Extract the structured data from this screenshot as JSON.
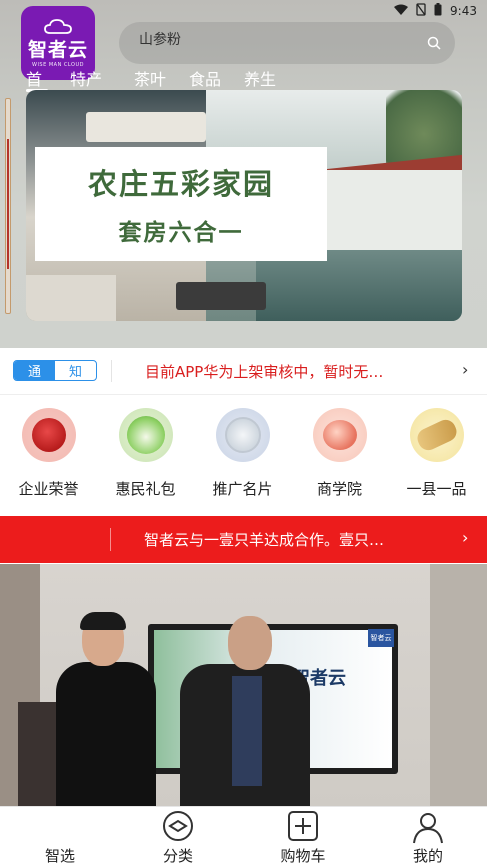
{
  "status_bar": {
    "time": "9:43"
  },
  "logo": {
    "text": "智者云",
    "sub": "WISE MAN CLOUD"
  },
  "search": {
    "placeholder": "山参粉"
  },
  "category_tabs": [
    "首",
    "特产",
    "茶叶",
    "食品",
    "养生"
  ],
  "banner": {
    "title": "农庄五彩家园",
    "subtitle": "套房六合一"
  },
  "notice": {
    "tag1": "通",
    "tag2": "知",
    "message": "目前APP华为上架审核中，暂时无…",
    "chevron": "›"
  },
  "quick_categories": [
    {
      "label": "企业荣誉",
      "icon": "rose-icon"
    },
    {
      "label": "惠民礼包",
      "icon": "cabbage-icon"
    },
    {
      "label": "推广名片",
      "icon": "card-icon"
    },
    {
      "label": "商学院",
      "icon": "peach-icon"
    },
    {
      "label": "一县一品",
      "icon": "ginseng-icon"
    }
  ],
  "announcement": {
    "message": "智者云与一壹只羊达成合作。壹只…",
    "chevron": "›"
  },
  "photo": {
    "screen_title": "智者云",
    "screen_badge": "智者云"
  },
  "bottom_nav": [
    {
      "label": "智选",
      "icon": "home-icon"
    },
    {
      "label": "分类",
      "icon": "category-icon"
    },
    {
      "label": "购物车",
      "icon": "cart-icon"
    },
    {
      "label": "我的",
      "icon": "profile-icon"
    }
  ],
  "colors": {
    "brand_purple": "#7a1ab3",
    "notice_blue": "#2c90e8",
    "alert_red": "#ec1c1c",
    "notice_text_red": "#d91e1e"
  }
}
